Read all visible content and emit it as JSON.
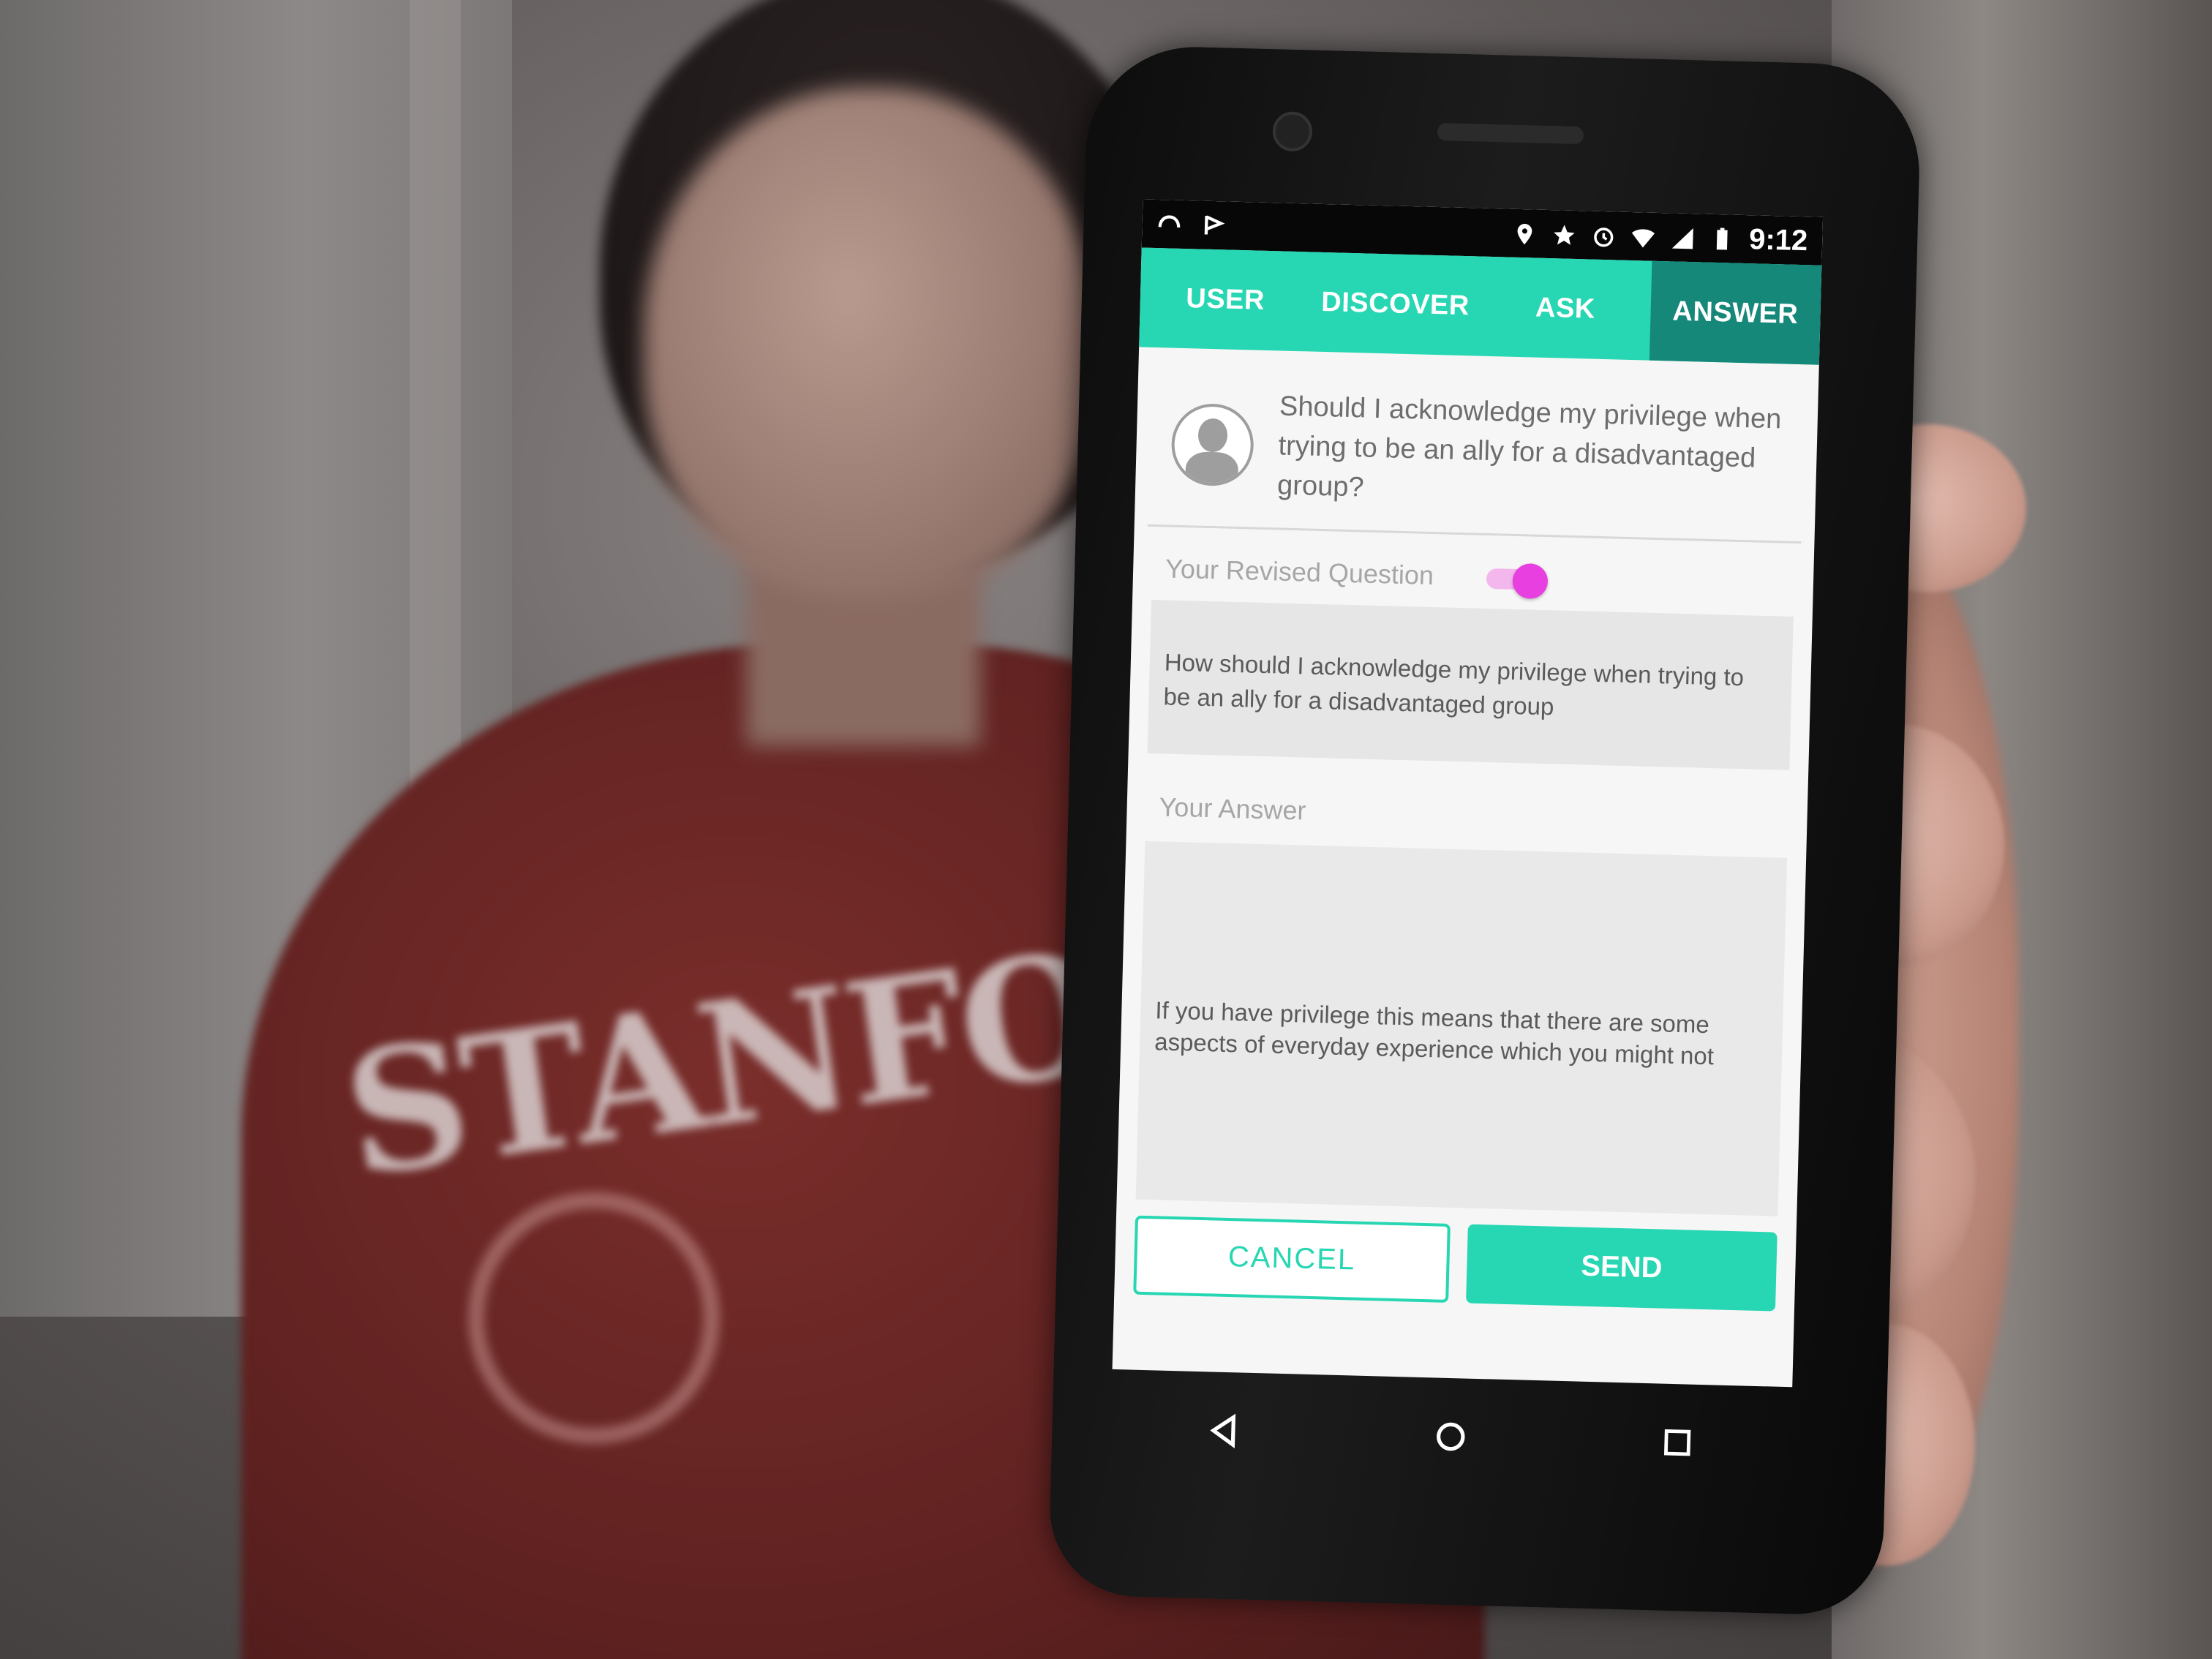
{
  "status_bar": {
    "time": "9:12",
    "icons": [
      "headphones-icon",
      "signal-flag-icon",
      "location-icon",
      "star-icon",
      "alarm-icon",
      "wifi-icon",
      "cell-signal-icon",
      "battery-icon"
    ]
  },
  "tabs": [
    {
      "label": "USER",
      "active": false
    },
    {
      "label": "DISCOVER",
      "active": false
    },
    {
      "label": "ASK",
      "active": false
    },
    {
      "label": "ANSWER",
      "active": true
    }
  ],
  "question": {
    "text": "Should I acknowledge my privilege when trying to be an ally for a disadvantaged group?"
  },
  "revised": {
    "label": "Your Revised Question",
    "toggle_on": true,
    "value": "How should I acknowledge my privilege when trying to be an ally for a disadvantaged group"
  },
  "answer": {
    "label": "Your Answer",
    "value": "If you have privilege this means that there are some aspects of everyday experience which you might not"
  },
  "buttons": {
    "cancel": "CANCEL",
    "send": "SEND"
  },
  "colors": {
    "accent": "#27d6b2",
    "active_tab": "#16887a",
    "toggle": "#e83fe0"
  },
  "background": {
    "shirt_text": "STANFORD"
  }
}
